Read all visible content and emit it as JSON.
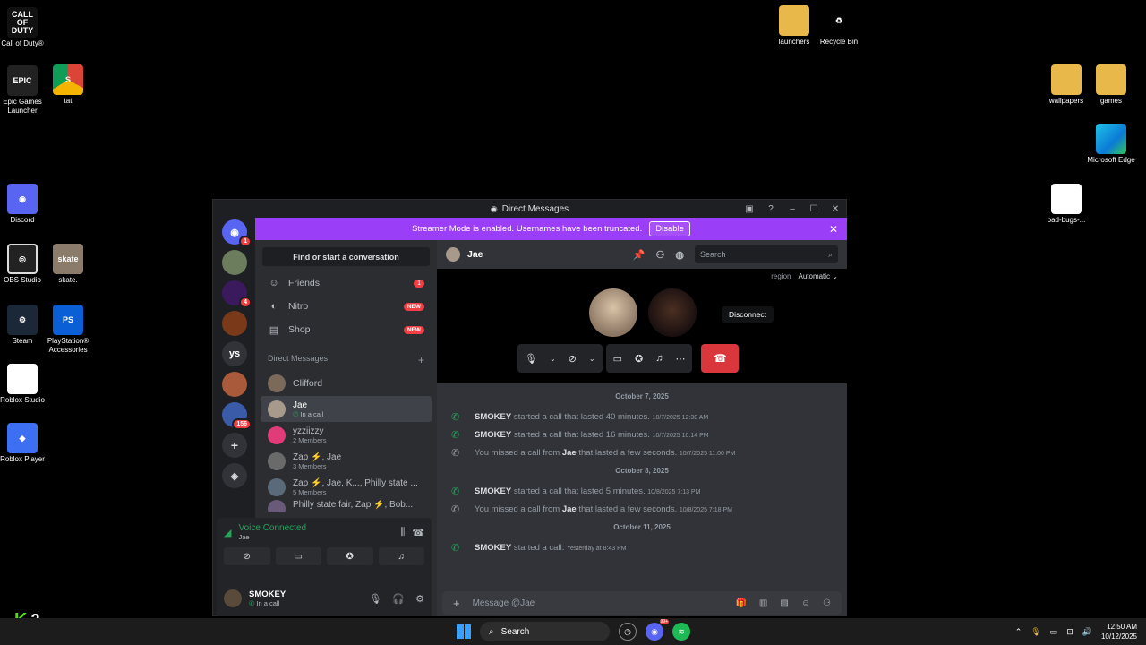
{
  "desktop": {
    "icons_left": [
      {
        "label": "Call of Duty®",
        "glyph": "CALL OF DUTY"
      },
      {
        "label": "Epic Games Launcher",
        "glyph": "EPIC"
      },
      {
        "label": "tat",
        "glyph": "S"
      },
      {
        "label": "Discord",
        "glyph": "◉"
      },
      {
        "label": "OBS Studio",
        "glyph": "◎"
      },
      {
        "label": "skate.",
        "glyph": "skate"
      },
      {
        "label": "Steam",
        "glyph": "⚙"
      },
      {
        "label": "PlayStation® Accessories",
        "glyph": "PS"
      },
      {
        "label": "Roblox Studio",
        "glyph": "▣"
      },
      {
        "label": "Roblox Player",
        "glyph": "◆"
      }
    ],
    "icons_right": [
      {
        "label": "launchers"
      },
      {
        "label": "Recycle Bin",
        "glyph": "♻"
      },
      {
        "label": "wallpapers"
      },
      {
        "label": "games"
      },
      {
        "label": "Microsoft Edge"
      },
      {
        "label": "bad-bugs-..."
      }
    ]
  },
  "window": {
    "title": "Direct Messages",
    "banner_text": "Streamer Mode is enabled. Usernames have been truncated.",
    "banner_button": "Disable"
  },
  "servers": [
    {
      "badge": "1"
    },
    {
      "badge": ""
    },
    {
      "badge": "4"
    },
    {
      "badge": ""
    },
    {
      "label": "ys"
    },
    {
      "badge": ""
    },
    {
      "badge": "156"
    }
  ],
  "sidebar": {
    "find": "Find or start a conversation",
    "nav": [
      {
        "label": "Friends",
        "badge": "1"
      },
      {
        "label": "Nitro",
        "tag": "NEW"
      },
      {
        "label": "Shop",
        "tag": "NEW"
      }
    ],
    "dm_header": "Direct Messages",
    "dms": [
      {
        "name": "Clifford",
        "sub": ""
      },
      {
        "name": "Jae",
        "sub": "In a call"
      },
      {
        "name": "yzziizzy",
        "sub": "2 Members"
      },
      {
        "name": "Zap ⚡, Jae",
        "sub": "3 Members"
      },
      {
        "name": "Zap ⚡, Jae, K..., Philly state ...",
        "sub": "5 Members"
      },
      {
        "name": "Philly state fair, Zap ⚡, Bob...",
        "sub": ""
      }
    ]
  },
  "voice": {
    "title": "Voice Connected",
    "channel": "Jae"
  },
  "user": {
    "name": "SMOKEY",
    "status": "In a call"
  },
  "chat": {
    "header_name": "Jae",
    "search_placeholder": "Search",
    "region_label": "region",
    "region_value": "Automatic",
    "tooltip": "Disconnect",
    "composer_placeholder": "Message @Jae",
    "groups": [
      {
        "date": "October 7, 2025",
        "messages": [
          {
            "who": "SMOKEY",
            "text": "started a call that lasted 40 minutes.",
            "ts": "10/7/2025 12:30 AM",
            "missed": false
          },
          {
            "who": "SMOKEY",
            "text": "started a call that lasted 16 minutes.",
            "ts": "10/7/2025 10:14 PM",
            "missed": false
          },
          {
            "pre": "You missed a call from",
            "who": "Jae",
            "text": "that lasted a few seconds.",
            "ts": "10/7/2025 11:00 PM",
            "missed": true
          }
        ]
      },
      {
        "date": "October 8, 2025",
        "messages": [
          {
            "who": "SMOKEY",
            "text": "started a call that lasted 5 minutes.",
            "ts": "10/8/2025 7:13 PM",
            "missed": false
          },
          {
            "pre": "You missed a call from",
            "who": "Jae",
            "text": "that lasted a few seconds.",
            "ts": "10/8/2025 7:18 PM",
            "missed": true
          }
        ]
      },
      {
        "date": "October 11, 2025",
        "messages": [
          {
            "who": "SMOKEY",
            "text": "started a call.",
            "ts": "Yesterday at 8:43 PM",
            "missed": false
          }
        ]
      }
    ]
  },
  "taskbar": {
    "search": "Search",
    "time": "12:50 AM",
    "date": "10/12/2025",
    "discord_badge": "99+"
  },
  "overlay": {
    "k_glyph": "K",
    "k_number": "2"
  },
  "colors": {
    "discord_blurple": "#5865f2",
    "streamer_purple": "#9b3ef7",
    "call_green": "#23a55a",
    "danger_red": "#da373c"
  }
}
